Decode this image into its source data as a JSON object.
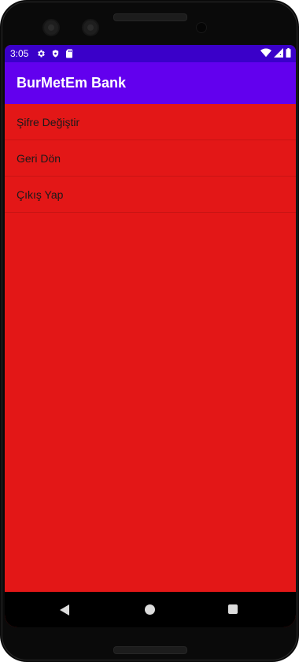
{
  "status_bar": {
    "time": "3:05",
    "icons_left": [
      "gear-icon",
      "shield-icon",
      "sd-card-icon"
    ],
    "icons_right": [
      "wifi-icon",
      "signal-icon",
      "battery-icon"
    ],
    "background": "#3a00c9"
  },
  "app_bar": {
    "title": "BurMetEm Bank",
    "background": "#6200ee"
  },
  "menu": {
    "background": "#e31717",
    "items": [
      {
        "label": "Şifre Değiştir"
      },
      {
        "label": "Geri Dön"
      },
      {
        "label": "Çıkış Yap"
      }
    ]
  },
  "nav_bar": {
    "buttons": [
      "back-icon",
      "home-icon",
      "recents-icon"
    ]
  }
}
